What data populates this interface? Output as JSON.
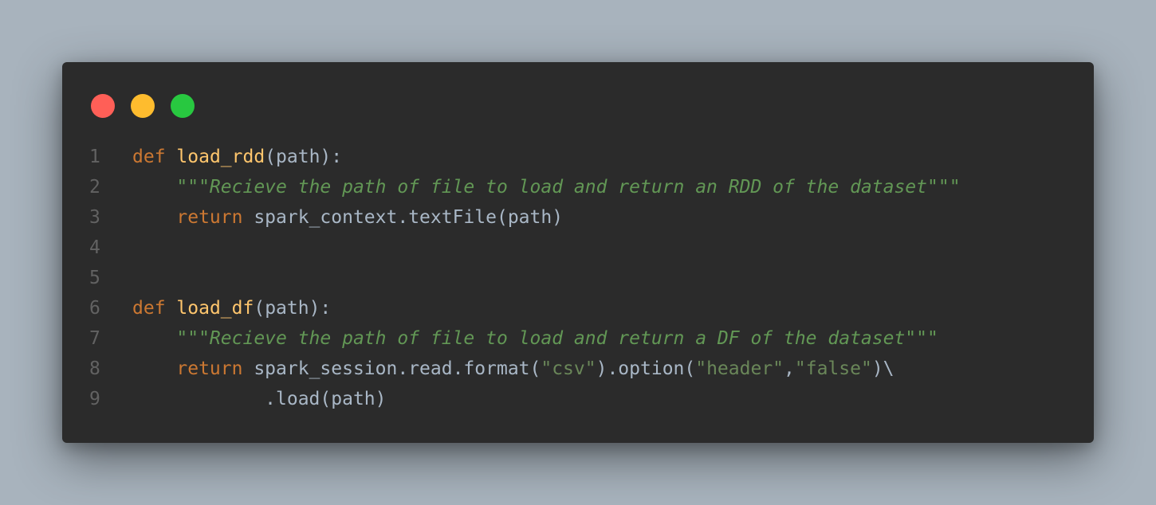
{
  "window": {
    "controls": [
      {
        "name": "close-button",
        "color": "#ff5f57"
      },
      {
        "name": "minimize-button",
        "color": "#febc2e"
      },
      {
        "name": "maximize-button",
        "color": "#28c840"
      }
    ]
  },
  "editor": {
    "lines": [
      {
        "number": "1",
        "tokens": [
          {
            "type": "kw",
            "text": "def"
          },
          {
            "type": "plain",
            "text": " "
          },
          {
            "type": "fn",
            "text": "load_rdd"
          },
          {
            "type": "plain",
            "text": "(path):"
          }
        ]
      },
      {
        "number": "2",
        "tokens": [
          {
            "type": "plain",
            "text": "    "
          },
          {
            "type": "doc",
            "text": "\"\"\"Recieve the path of file to load and return an RDD of the dataset\"\"\""
          }
        ]
      },
      {
        "number": "3",
        "tokens": [
          {
            "type": "plain",
            "text": "    "
          },
          {
            "type": "kw",
            "text": "return"
          },
          {
            "type": "plain",
            "text": " spark_context.textFile(path)"
          }
        ]
      },
      {
        "number": "4",
        "tokens": []
      },
      {
        "number": "5",
        "tokens": []
      },
      {
        "number": "6",
        "tokens": [
          {
            "type": "kw",
            "text": "def"
          },
          {
            "type": "plain",
            "text": " "
          },
          {
            "type": "fn",
            "text": "load_df"
          },
          {
            "type": "plain",
            "text": "(path):"
          }
        ]
      },
      {
        "number": "7",
        "tokens": [
          {
            "type": "plain",
            "text": "    "
          },
          {
            "type": "doc",
            "text": "\"\"\"Recieve the path of file to load and return a DF of the dataset\"\"\""
          }
        ]
      },
      {
        "number": "8",
        "tokens": [
          {
            "type": "plain",
            "text": "    "
          },
          {
            "type": "kw",
            "text": "return"
          },
          {
            "type": "plain",
            "text": " spark_session.read.format("
          },
          {
            "type": "str",
            "text": "\"csv\""
          },
          {
            "type": "plain",
            "text": ").option("
          },
          {
            "type": "str",
            "text": "\"header\""
          },
          {
            "type": "plain",
            "text": ","
          },
          {
            "type": "str",
            "text": "\"false\""
          },
          {
            "type": "plain",
            "text": ")\\"
          }
        ]
      },
      {
        "number": "9",
        "tokens": [
          {
            "type": "plain",
            "text": "            .load(path)"
          }
        ]
      }
    ]
  }
}
